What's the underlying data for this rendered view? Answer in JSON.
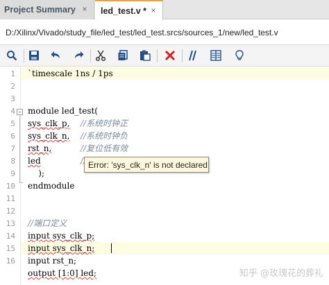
{
  "tabs": [
    {
      "label": "Project Summary",
      "close": "×"
    },
    {
      "label": "led_test.v *",
      "close": "×"
    }
  ],
  "path": "D:/Xilinx/Vivado/study_file/led_test/led_test.srcs/sources_1/new/led_test.v",
  "toolbar": {
    "icons": [
      "search-icon",
      "save-icon",
      "undo-icon",
      "redo-icon",
      "cut-icon",
      "copy-icon",
      "paste-icon",
      "delete-icon",
      "comment-icon",
      "column-select-icon",
      "insert-template-icon"
    ],
    "delete_color": "#d62020",
    "accent_color": "#1f4e8c"
  },
  "editor": {
    "line_numbers": [
      "1",
      "2",
      "3",
      "4",
      "5",
      "6",
      "7",
      "8",
      "9",
      "10",
      "11",
      "12",
      "13",
      "14",
      "15",
      "16"
    ],
    "lines": [
      {
        "text": "`timescale 1ns / 1ps"
      },
      {
        "text": ""
      },
      {
        "text": ""
      },
      {
        "text": "module led_test("
      },
      {
        "text": "sys_clk_p,",
        "comment": "//系统时钟正"
      },
      {
        "text": "sys_clk_n,",
        "comment": "//系统时钟负"
      },
      {
        "text": "rst_n,",
        "comment": "//复位低有效"
      },
      {
        "text": "led",
        "comment": "//"
      },
      {
        "text": "    );"
      },
      {
        "text": "endmodule"
      },
      {
        "text": ""
      },
      {
        "text": ""
      },
      {
        "comment": "//端口定义"
      },
      {
        "text": "input sys_clk_p;"
      },
      {
        "text": "input sys_clk_n;"
      },
      {
        "text": "input rst_n;"
      },
      {
        "text": "output [1:0] led;"
      }
    ],
    "highlight_color": "#fcfce2"
  },
  "error_tooltip": "Error: 'sys_clk_n' is not declared",
  "watermark": "知乎 @玫瑰花的葬礼"
}
